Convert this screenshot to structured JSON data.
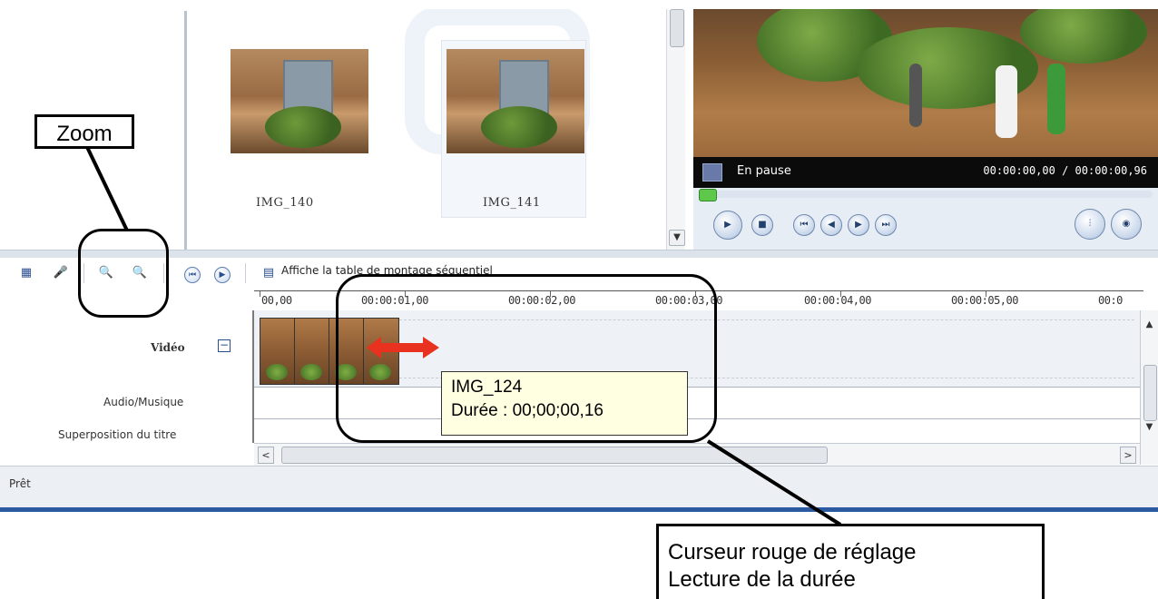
{
  "collection": {
    "thumbnails": [
      {
        "label": "IMG_140"
      },
      {
        "label": "IMG_141"
      }
    ]
  },
  "preview": {
    "status": "En pause",
    "time": "00:00:00,00 / 00:00:00,96"
  },
  "toolbar": {
    "storyboard_label": "Affiche la table de montage séquentiel"
  },
  "timeline": {
    "ruler_ticks": [
      "00,00",
      "00:00:01,00",
      "00:00:02,00",
      "00:00:03,00",
      "00:00:04,00",
      "00:00:05,00",
      "00:0"
    ],
    "tracks": {
      "video": "Vidéo",
      "audio": "Audio/Musique",
      "title": "Superposition du titre"
    }
  },
  "tooltip": {
    "name": "IMG_124",
    "duration": "Durée : 00;00;00,16"
  },
  "status_bar": {
    "text": "Prêt"
  },
  "annotations": {
    "zoom": "Zoom",
    "cursor_line1": "Curseur rouge de réglage",
    "cursor_line2": "Lecture de la durée"
  },
  "colors": {
    "resize_cursor": "#e8311e",
    "tooltip_bg": "#ffffe1",
    "accent": "#2c5aa0"
  }
}
